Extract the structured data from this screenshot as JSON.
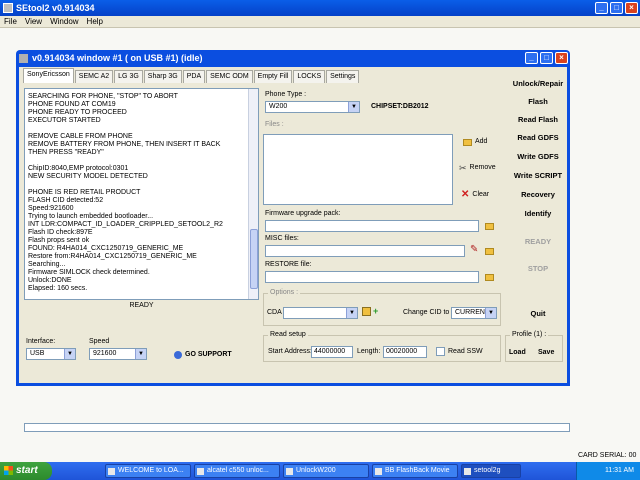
{
  "outer_window": {
    "title": "SEtool2 v0.914034"
  },
  "menu": [
    "File",
    "View",
    "Window",
    "Help"
  ],
  "inner_window": {
    "title": "v0.914034 window #1 ( on USB #1) (idle)"
  },
  "tabs": [
    "SonyEricsson",
    "SEMC A2",
    "LG 3G",
    "Sharp 3G",
    "PDA",
    "SEMC ODM",
    "Empty Fill",
    "LOCKS",
    "Settings"
  ],
  "log": [
    "SEARCHING FOR PHONE, \"STOP\" TO ABORT",
    "PHONE FOUND AT COM19",
    "PHONE READY TO PROCEED",
    "EXECUTOR STARTED",
    "",
    "REMOVE CABLE FROM PHONE",
    "REMOVE BATTERY FROM PHONE, THEN INSERT IT BACK",
    "THEN PRESS \"READY\"",
    "",
    "ChipID:8040,EMP protocol:0301",
    "NEW SECURITY MODEL DETECTED",
    "",
    "PHONE IS RED RETAIL PRODUCT",
    "FLASH CID detected:52",
    "Speed:921600",
    "Trying to launch embedded bootloader...",
    "INT LDR:COMPACT_ID_LOADER_CRIPPLED_SETOOL2_R2",
    "Flash ID check:897E",
    "Flash props sent ok",
    "FOUND: R4HA014_CXC1250719_GENERIC_ME",
    "Restore from:R4HA014_CXC1250719_GENERIC_ME",
    "Searching...",
    "Firmware SIMLOCK check determined.",
    "Unlock:DONE",
    "Elapsed: 160 secs."
  ],
  "status": "READY",
  "phone_type": {
    "label": "Phone Type :",
    "value": "W200",
    "chipset": "CHIPSET:DB2012"
  },
  "files": {
    "label": "Files :",
    "add": "Add",
    "remove": "Remove",
    "clear": "Clear"
  },
  "firmware": {
    "label": "Firmware upgrade pack:"
  },
  "misc": {
    "label": "MISC files:"
  },
  "restore": {
    "label": "RESTORE file:"
  },
  "options": {
    "label": "Options :",
    "cda_label": "CDA",
    "change_cid_label": "Change CID to",
    "change_cid_value": "CURRENT"
  },
  "interface": {
    "label": "Interface:",
    "value": "USB"
  },
  "speed": {
    "label": "Speed",
    "value": "921600"
  },
  "go_support": "GO SUPPORT",
  "read_setup": {
    "title": "Read setup",
    "start_label": "Start Address:",
    "start_value": "44000000",
    "length_label": "Length:",
    "length_value": "00020000",
    "ssw_label": "Read SSW"
  },
  "profile": {
    "title": "Profile (1) :",
    "load": "Load",
    "save": "Save"
  },
  "right_buttons": [
    "Unlock/Repair",
    "Flash",
    "Read Flash",
    "Read GDFS",
    "Write GDFS",
    "Write SCRIPT",
    "Recovery",
    "Identify"
  ],
  "ready_button": "READY",
  "stop_button": "STOP",
  "quit_button": "Quit",
  "card_serial": "CARD SERIAL: 00",
  "taskbar": {
    "start": "start",
    "tasks": [
      "WELCOME to LOA...",
      "alcatel c550 unloc...",
      "UnlockW200",
      "BB FlashBack Movie",
      "setool2g"
    ],
    "clock": "11:31 AM"
  }
}
